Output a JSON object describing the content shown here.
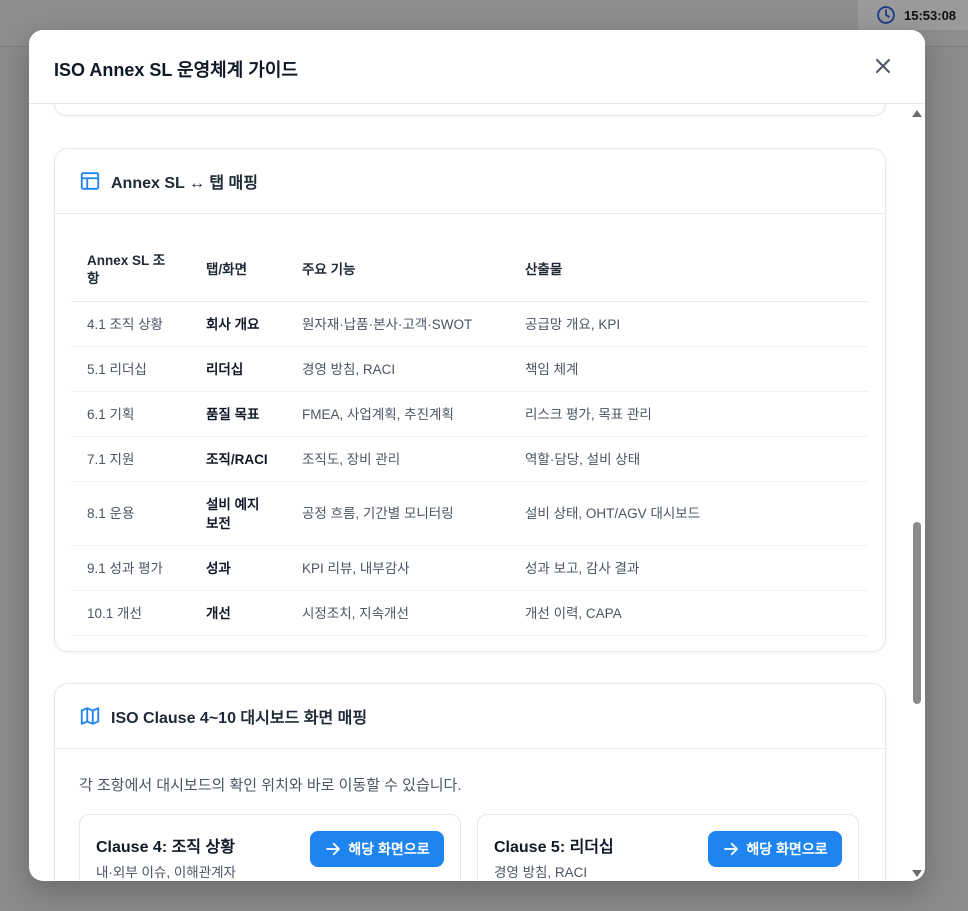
{
  "background": {
    "clock_time": "15:53:08"
  },
  "modal": {
    "title": "ISO Annex SL 운영체계 가이드"
  },
  "mapping_card": {
    "title": "Annex SL ↔ 탭 매핑",
    "icon": "table-icon",
    "columns": [
      "Annex SL 조항",
      "탭/화면",
      "주요 기능",
      "산출물"
    ],
    "rows": [
      {
        "clause": "4.1 조직 상황",
        "tab": "회사 개요",
        "feature": "원자재·납품·본사·고객·SWOT",
        "output": "공급망 개요, KPI"
      },
      {
        "clause": "5.1 리더십",
        "tab": "리더십",
        "feature": "경영 방침, RACI",
        "output": "책임 체계"
      },
      {
        "clause": "6.1 기획",
        "tab": "품질 목표",
        "feature": "FMEA, 사업계획, 추진계획",
        "output": "리스크 평가, 목표 관리"
      },
      {
        "clause": "7.1 지원",
        "tab": "조직/RACI",
        "feature": "조직도, 장비 관리",
        "output": "역할·담당, 설비 상태"
      },
      {
        "clause": "8.1 운용",
        "tab": "설비 예지 보전",
        "feature": "공정 흐름, 기간별 모니터링",
        "output": "설비 상태, OHT/AGV 대시보드"
      },
      {
        "clause": "9.1 성과 평가",
        "tab": "성과",
        "feature": "KPI 리뷰, 내부감사",
        "output": "성과 보고, 감사 결과"
      },
      {
        "clause": "10.1 개선",
        "tab": "개선",
        "feature": "시정조치, 지속개선",
        "output": "개선 이력, CAPA"
      }
    ]
  },
  "clause_card": {
    "title": "ISO Clause 4~10 대시보드 화면 매핑",
    "icon": "map-icon",
    "description": "각 조항에서 대시보드의 확인 위치와 바로 이동할 수 있습니다.",
    "clauses": [
      {
        "title": "Clause 4: 조직 상황",
        "subtitle": "내·외부 이슈, 이해관계자",
        "button": "해당 화면으로"
      },
      {
        "title": "Clause 5: 리더십",
        "subtitle": "경영 방침, RACI",
        "button": "해당 화면으로"
      }
    ]
  },
  "colors": {
    "accent": "#1d84f0",
    "border": "#e5e7eb"
  }
}
